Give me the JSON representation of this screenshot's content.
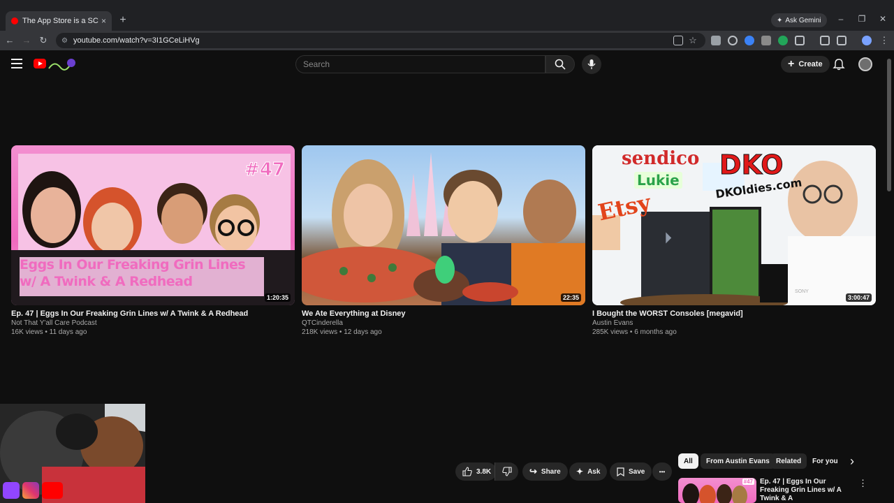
{
  "browser": {
    "tab_title": "The App Store is a SCAM - You",
    "tab_close": "×",
    "new_tab": "+",
    "ask_gemini": "Ask Gemini",
    "url": "youtube.com/watch?v=3I1GCeLiHVg",
    "window_controls": [
      "–",
      "❐",
      "✕"
    ]
  },
  "youtube": {
    "search_placeholder": "Search",
    "create_label": "Create",
    "videos": [
      {
        "title": "Ep. 47 | Eggs In Our Freaking Grin Lines w/ A Twink & A Redhead",
        "channel": "Not That Y'all Care Podcast",
        "meta": "16K views • 11 days ago",
        "duration": "1:20:35",
        "thumb_badge": "#47",
        "thumb_line1": "Eggs In Our Freaking Grin Lines",
        "thumb_line2": "w/ A Twink & A Redhead"
      },
      {
        "title": "We Ate Everything at Disney",
        "channel": "QTCinderella",
        "meta": "218K views • 12 days ago",
        "duration": "22:35"
      },
      {
        "title": "I Bought the WORST Consoles [megavid]",
        "channel": "Austin Evans",
        "meta": "285K views • 6 months ago",
        "duration": "3:00:47",
        "thumb_words": [
          "sendico",
          "DKO",
          "Lukie",
          "Etsy",
          "DKOldies.com",
          "SONY"
        ]
      }
    ],
    "actions": {
      "likes": "3.8K",
      "share": "Share",
      "ask": "Ask",
      "save": "Save",
      "more": "•••"
    },
    "chips": [
      "All",
      "From Austin Evans",
      "Related",
      "For you"
    ],
    "chip_next": "›",
    "recommended": {
      "title": "Ep. 47 | Eggs In Our Freaking Grin Lines w/ A Twink & A",
      "badge": "#47"
    }
  },
  "colors": {
    "background": "#0f0f0f",
    "youtube_red": "#ff0000",
    "thumb_pink": "#f06bbf"
  }
}
